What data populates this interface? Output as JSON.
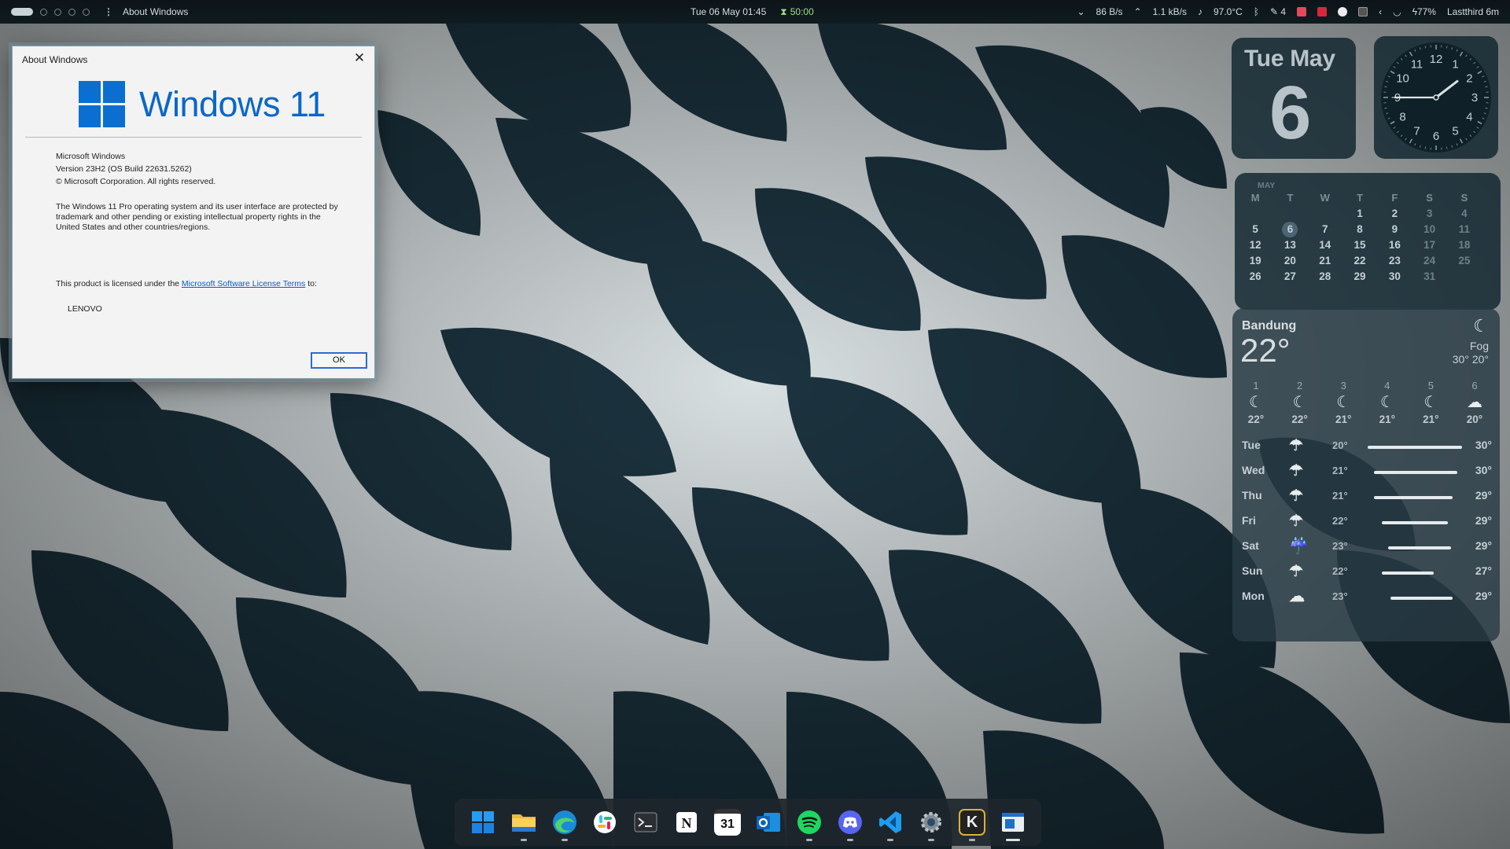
{
  "topbar": {
    "active_window": "About Windows",
    "datetime": "Tue 06 May 01:45",
    "timer": "50:00",
    "net_down": "86 B/s",
    "net_up": "1.1 kB/s",
    "temperature": "97.0°C",
    "notify_count": "4",
    "battery": "77%",
    "lastthird": "Lastthird 6m"
  },
  "dialog": {
    "title": "About Windows",
    "brand": "Windows 11",
    "product": "Microsoft Windows",
    "version": "Version 23H2 (OS Build 22631.5262)",
    "copyright": "© Microsoft Corporation. All rights reserved.",
    "legal_text": "The Windows 11 Pro operating system and its user interface are protected by trademark and other pending or existing intellectual property rights in the United States and other countries/regions.",
    "license_prefix": "This product is licensed under the ",
    "license_link": "Microsoft Software License Terms",
    "license_suffix": " to:",
    "licensee": "LENOVO",
    "ok_label": "OK"
  },
  "date_widget": {
    "weekday_month": "Tue May",
    "day": "6"
  },
  "clock_widget": {
    "hour": 1,
    "minute": 45,
    "second": 45,
    "numerals": [
      "12",
      "1",
      "2",
      "3",
      "4",
      "5",
      "6",
      "7",
      "8",
      "9",
      "10",
      "11"
    ]
  },
  "calendar": {
    "month": "MAY",
    "weekdays": [
      "M",
      "T",
      "W",
      "T",
      "F",
      "S",
      "S"
    ],
    "weeks": [
      [
        "",
        "",
        "",
        "1",
        "2",
        "3",
        "4"
      ],
      [
        "5",
        "6",
        "7",
        "8",
        "9",
        "10",
        "11"
      ],
      [
        "12",
        "13",
        "14",
        "15",
        "16",
        "17",
        "18"
      ],
      [
        "19",
        "20",
        "21",
        "22",
        "23",
        "24",
        "25"
      ],
      [
        "26",
        "27",
        "28",
        "29",
        "30",
        "31",
        ""
      ]
    ],
    "today": "6"
  },
  "weather": {
    "city": "Bandung",
    "temp": "22°",
    "condition": "Fog",
    "hi_lo": "30° 20°",
    "hourly": [
      {
        "hour": "1",
        "icon": "moon-cloud-icon",
        "temp": "22°"
      },
      {
        "hour": "2",
        "icon": "moon-cloud-icon",
        "temp": "22°"
      },
      {
        "hour": "3",
        "icon": "moon-cloud-icon",
        "temp": "21°"
      },
      {
        "hour": "4",
        "icon": "moon-cloud-icon",
        "temp": "21°"
      },
      {
        "hour": "5",
        "icon": "moon-cloud-icon",
        "temp": "21°"
      },
      {
        "hour": "6",
        "icon": "fog-icon",
        "temp": "20°"
      }
    ],
    "daily": [
      {
        "day": "Tue",
        "icon": "rain-cloud-icon",
        "low": "20°",
        "high": "30°",
        "range_start": 0.0,
        "range_end": 1.0
      },
      {
        "day": "Wed",
        "icon": "rain-cloud-icon",
        "low": "21°",
        "high": "30°",
        "range_start": 0.07,
        "range_end": 0.95
      },
      {
        "day": "Thu",
        "icon": "rain-cloud-icon",
        "low": "21°",
        "high": "29°",
        "range_start": 0.07,
        "range_end": 0.9
      },
      {
        "day": "Fri",
        "icon": "rain-cloud-icon",
        "low": "22°",
        "high": "29°",
        "range_start": 0.15,
        "range_end": 0.85
      },
      {
        "day": "Sat",
        "icon": "heavy-rain-icon",
        "low": "23°",
        "high": "29°",
        "range_start": 0.22,
        "range_end": 0.88
      },
      {
        "day": "Sun",
        "icon": "rain-cloud-icon",
        "low": "22°",
        "high": "27°",
        "range_start": 0.15,
        "range_end": 0.7
      },
      {
        "day": "Mon",
        "icon": "cloud-icon",
        "low": "23°",
        "high": "29°",
        "range_start": 0.24,
        "range_end": 0.9
      }
    ]
  },
  "dock": {
    "apps": [
      {
        "name": "start-menu",
        "icon": "windows-logo-icon",
        "bg": "#1b2630",
        "running": false,
        "active": false
      },
      {
        "name": "file-explorer",
        "icon": "folder-icon",
        "bg": "#1b2630",
        "running": true,
        "active": false
      },
      {
        "name": "edge",
        "icon": "edge-icon",
        "bg": "#1b2630",
        "running": true,
        "active": false
      },
      {
        "name": "slack",
        "icon": "slack-icon",
        "bg": "#1b2630",
        "running": false,
        "active": false
      },
      {
        "name": "terminal",
        "icon": "terminal-icon",
        "bg": "#1b2630",
        "running": false,
        "active": false
      },
      {
        "name": "notion",
        "icon": "notion-icon",
        "bg": "#1b2630",
        "running": false,
        "active": false
      },
      {
        "name": "calendar",
        "icon": "calendar-icon",
        "bg": "#1b2630",
        "running": false,
        "active": false,
        "text": "31"
      },
      {
        "name": "outlook",
        "icon": "outlook-icon",
        "bg": "#1b2630",
        "running": false,
        "active": false
      },
      {
        "name": "spotify",
        "icon": "spotify-icon",
        "bg": "#1b2630",
        "running": true,
        "active": false
      },
      {
        "name": "discord",
        "icon": "discord-icon",
        "bg": "#1b2630",
        "running": true,
        "active": false
      },
      {
        "name": "vscode",
        "icon": "vscode-icon",
        "bg": "#1b2630",
        "running": true,
        "active": false
      },
      {
        "name": "settings",
        "icon": "gear-icon",
        "bg": "#1b2630",
        "running": true,
        "active": false
      },
      {
        "name": "komorebi",
        "icon": "k-app-icon",
        "bg": "#1b2630",
        "running": true,
        "active": false,
        "text": "K"
      },
      {
        "name": "about-windows",
        "icon": "window-app-icon",
        "bg": "#1b2630",
        "running": true,
        "active": true
      }
    ]
  },
  "colors": {
    "accent": "#0a6fd1",
    "wallpaper_dark": "#1d3744",
    "wallpaper_light": "#dfe6e8"
  }
}
